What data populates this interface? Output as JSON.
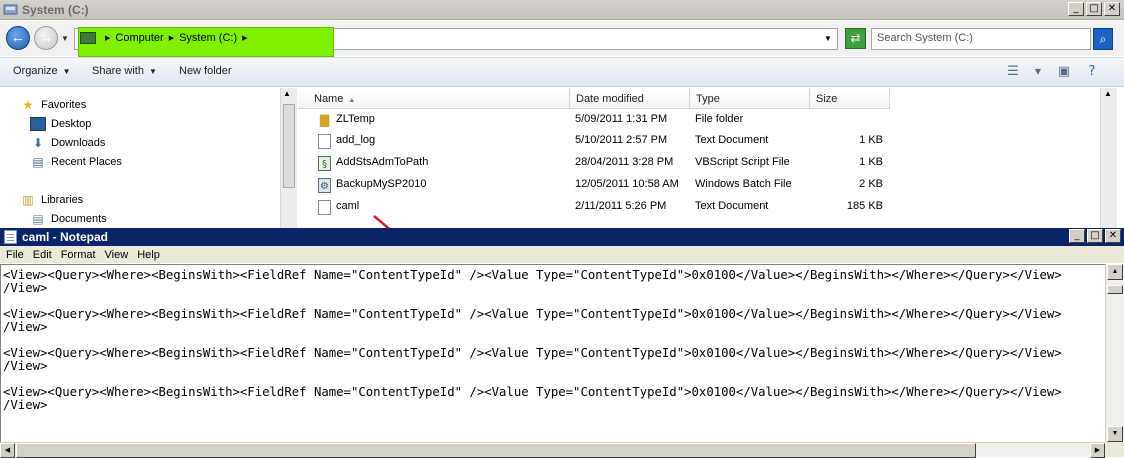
{
  "explorer": {
    "title": "System (C:)",
    "breadcrumb": [
      "Computer",
      "System (C:)"
    ],
    "search_placeholder": "Search System (C:)",
    "toolbar": {
      "organize": "Organize",
      "share_with": "Share with",
      "new_folder": "New folder"
    },
    "nav": {
      "favorites": "Favorites",
      "desktop": "Desktop",
      "downloads": "Downloads",
      "recent_places": "Recent Places",
      "libraries": "Libraries",
      "documents": "Documents"
    },
    "columns": {
      "name": "Name",
      "date": "Date modified",
      "type": "Type",
      "size": "Size"
    },
    "files": [
      {
        "name": "ZLTemp",
        "date": "5/09/2011 1:31 PM",
        "type": "File folder",
        "size": "",
        "icon": "folder-icon"
      },
      {
        "name": "add_log",
        "date": "5/10/2011 2:57 PM",
        "type": "Text Document",
        "size": "1 KB",
        "icon": "text-file-icon"
      },
      {
        "name": "AddStsAdmToPath",
        "date": "28/04/2011 3:28 PM",
        "type": "VBScript Script File",
        "size": "1 KB",
        "icon": "script-file-icon"
      },
      {
        "name": "BackupMySP2010",
        "date": "12/05/2011 10:58 AM",
        "type": "Windows Batch File",
        "size": "2 KB",
        "icon": "batch-file-icon"
      },
      {
        "name": "caml",
        "date": "2/11/2011 5:26 PM",
        "type": "Text Document",
        "size": "185 KB",
        "icon": "text-file-icon"
      }
    ],
    "highlight_color": "#7ff000"
  },
  "notepad": {
    "title": "caml - Notepad",
    "menu": [
      "File",
      "Edit",
      "Format",
      "View",
      "Help"
    ],
    "lines": [
      "<View><Query><Where><BeginsWith><FieldRef Name=\"ContentTypeId\" /><Value Type=\"ContentTypeId\">0x0100</Value></BeginsWith></Where></Query></View>",
      "/View>",
      "",
      "<View><Query><Where><BeginsWith><FieldRef Name=\"ContentTypeId\" /><Value Type=\"ContentTypeId\">0x0100</Value></BeginsWith></Where></Query></View>",
      "/View>",
      "",
      "<View><Query><Where><BeginsWith><FieldRef Name=\"ContentTypeId\" /><Value Type=\"ContentTypeId\">0x0100</Value></BeginsWith></Where></Query></View>",
      "/View>",
      "",
      "<View><Query><Where><BeginsWith><FieldRef Name=\"ContentTypeId\" /><Value Type=\"ContentTypeId\">0x0100</Value></BeginsWith></Where></Query></View>",
      "/View>"
    ],
    "title_bar_color": "#0a246a"
  },
  "annotation": {
    "arrow_color": "#e8141b"
  }
}
